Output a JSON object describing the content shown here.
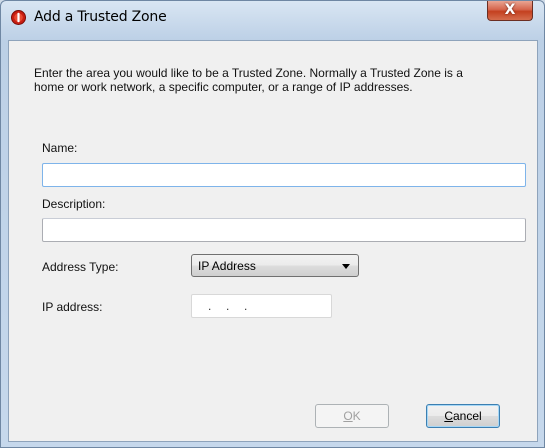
{
  "window": {
    "title": "Add a Trusted Zone",
    "close_label": "X"
  },
  "dialog": {
    "intro_line1": "Enter the area you would like to be a Trusted Zone. Normally a Trusted Zone is a",
    "intro_line2": "home or work network, a specific computer, or a range of IP addresses.",
    "name_label": "Name:",
    "name_value": "",
    "description_label": "Description:",
    "description_value": "",
    "address_type_label": "Address Type:",
    "address_type_value": "IP Address",
    "ip_label": "IP address:",
    "ip_dots": [
      ".",
      ".",
      "."
    ]
  },
  "buttons": {
    "ok_accel": "O",
    "ok_rest": "K",
    "cancel_accel": "C",
    "cancel_rest": "ancel"
  },
  "colors": {
    "app_icon_red": "#c81e12",
    "focus_border": "#7eb4ea",
    "close_red": "#c4401f"
  }
}
